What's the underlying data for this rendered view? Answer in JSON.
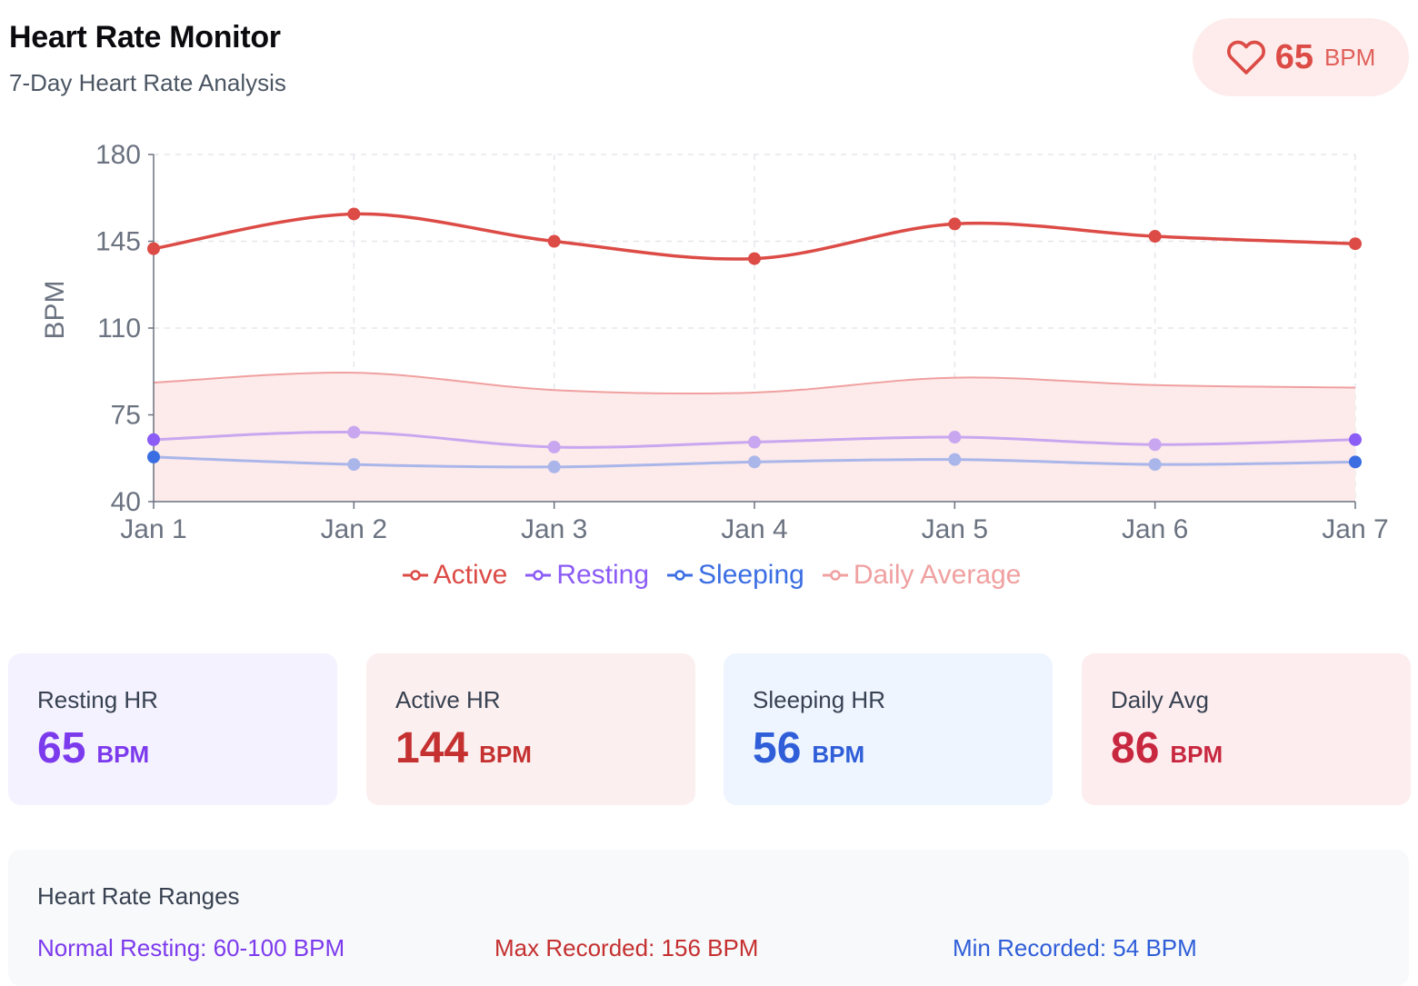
{
  "header": {
    "title": "Heart Rate Monitor",
    "subtitle": "7-Day Heart Rate Analysis",
    "badge_value": "65",
    "badge_unit": "BPM",
    "badge_icon": "heart-icon"
  },
  "colors": {
    "active": "#dc4b46",
    "resting": "#8b5cf6",
    "sleeping": "#3b6ee3",
    "daily_average": "#f0a0a0"
  },
  "chart_data": {
    "type": "line",
    "categories": [
      "Jan 1",
      "Jan 2",
      "Jan 3",
      "Jan 4",
      "Jan 5",
      "Jan 6",
      "Jan 7"
    ],
    "ylabel": "BPM",
    "ylim": [
      40,
      180
    ],
    "yticks": [
      "40",
      "75",
      "110",
      "145",
      "180"
    ],
    "grid": true,
    "legend_position": "bottom",
    "series": [
      {
        "name": "Active",
        "values": [
          142,
          156,
          145,
          138,
          152,
          147,
          144
        ]
      },
      {
        "name": "Resting",
        "values": [
          65,
          68,
          62,
          64,
          66,
          63,
          65
        ]
      },
      {
        "name": "Sleeping",
        "values": [
          58,
          55,
          54,
          56,
          57,
          55,
          56
        ]
      },
      {
        "name": "Daily Average",
        "values": [
          88,
          92,
          85,
          84,
          90,
          87,
          86
        ],
        "area": true
      }
    ]
  },
  "legend": [
    "Active",
    "Resting",
    "Sleeping",
    "Daily Average"
  ],
  "cards": [
    {
      "label": "Resting HR",
      "value": "65",
      "unit": "BPM"
    },
    {
      "label": "Active HR",
      "value": "144",
      "unit": "BPM"
    },
    {
      "label": "Sleeping HR",
      "value": "56",
      "unit": "BPM"
    },
    {
      "label": "Daily Avg",
      "value": "86",
      "unit": "BPM"
    }
  ],
  "ranges": {
    "title": "Heart Rate Ranges",
    "normal": "Normal Resting: 60-100 BPM",
    "max": "Max Recorded: 156 BPM",
    "min": "Min Recorded: 54 BPM"
  }
}
